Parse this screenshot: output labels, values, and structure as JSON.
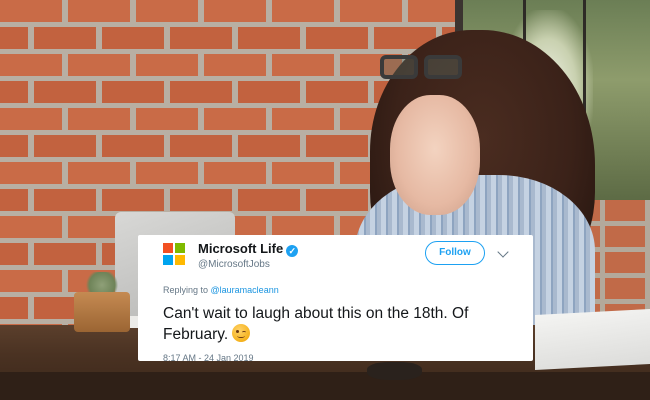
{
  "tweet": {
    "account_name": "Microsoft Life",
    "handle": "@MicrosoftJobs",
    "verified_badge": "✓",
    "follow_label": "Follow",
    "replying_prefix": "Replying to ",
    "replying_to": "@lauramacleann",
    "text": "Can't wait to laugh about this on the 18th. Of February.",
    "emoji": "winking-face-icon",
    "timestamp": "8:17 AM - 24 Jan 2019"
  },
  "colors": {
    "twitter_blue": "#1da1f2",
    "mention_blue": "#1b95e0",
    "muted_text": "#657786",
    "ms_red": "#f25022",
    "ms_green": "#7fba00",
    "ms_blue": "#00a4ef",
    "ms_yellow": "#ffb900"
  },
  "icons": {
    "logo": "microsoft-logo-icon",
    "verified": "verified-badge-icon",
    "menu": "chevron-down-icon"
  }
}
